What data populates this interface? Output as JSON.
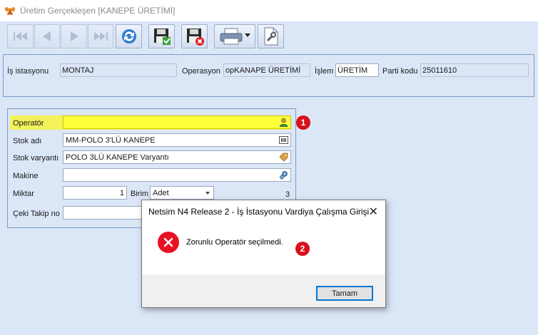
{
  "window": {
    "title": "Üretim Gerçekleşen [KANEPE ÜRETİMİ]",
    "app_icon": "butterfly-icon"
  },
  "toolbar": {
    "buttons": [
      {
        "name": "first-record-button",
        "icon": "first-icon",
        "enabled": false
      },
      {
        "name": "prev-record-button",
        "icon": "prev-icon",
        "enabled": false
      },
      {
        "name": "next-record-button",
        "icon": "next-icon",
        "enabled": false
      },
      {
        "name": "last-record-button",
        "icon": "last-icon",
        "enabled": false
      },
      {
        "name": "refresh-button",
        "icon": "refresh-icon",
        "enabled": true
      },
      {
        "name": "save-button",
        "icon": "save-check-icon",
        "enabled": true
      },
      {
        "name": "save-cancel-button",
        "icon": "save-cancel-icon",
        "enabled": true
      },
      {
        "name": "print-button",
        "icon": "printer-icon",
        "enabled": true
      },
      {
        "name": "tools-button",
        "icon": "settings-page-icon",
        "enabled": true
      }
    ]
  },
  "header": {
    "workstation_label": "İş istasyonu",
    "workstation_value": "MONTAJ",
    "operation_label": "Operasyon",
    "operation_value": "opKANAPE ÜRETİMİ",
    "process_label": "İşlem",
    "process_value": "ÜRETİM",
    "batch_label": "Parti kodu",
    "batch_value": "25011610"
  },
  "form": {
    "operator_label": "Operatör",
    "operator_value": "",
    "stock_name_label": "Stok adı",
    "stock_name_value": "MM-POLO 3'LÜ KANEPE",
    "stock_variant_label": "Stok varyantı",
    "stock_variant_value": "POLO 3LÜ KANEPE Varyantı",
    "machine_label": "Makine",
    "machine_value": "",
    "quantity_label": "Miktar",
    "quantity_value": "1",
    "unit_label": "Birim",
    "unit_value": "Adet",
    "count_value": "3",
    "tracking_label": "Çeki Takip no",
    "tracking_value": ""
  },
  "annotations": {
    "badge1": "1",
    "badge2": "2"
  },
  "dialog": {
    "title": "Netsim N4 Release 2 - İş İstasyonu Vardiya Çalışma Girişi",
    "message": "Zorunlu Operatör seçilmedi.",
    "ok_label": "Tamam",
    "close_glyph": "✕"
  },
  "colors": {
    "background": "#dbe6f7",
    "highlight": "#f2f25a",
    "badge": "#d8101b",
    "error": "#e81123",
    "panel_border": "#7b9cc8"
  }
}
